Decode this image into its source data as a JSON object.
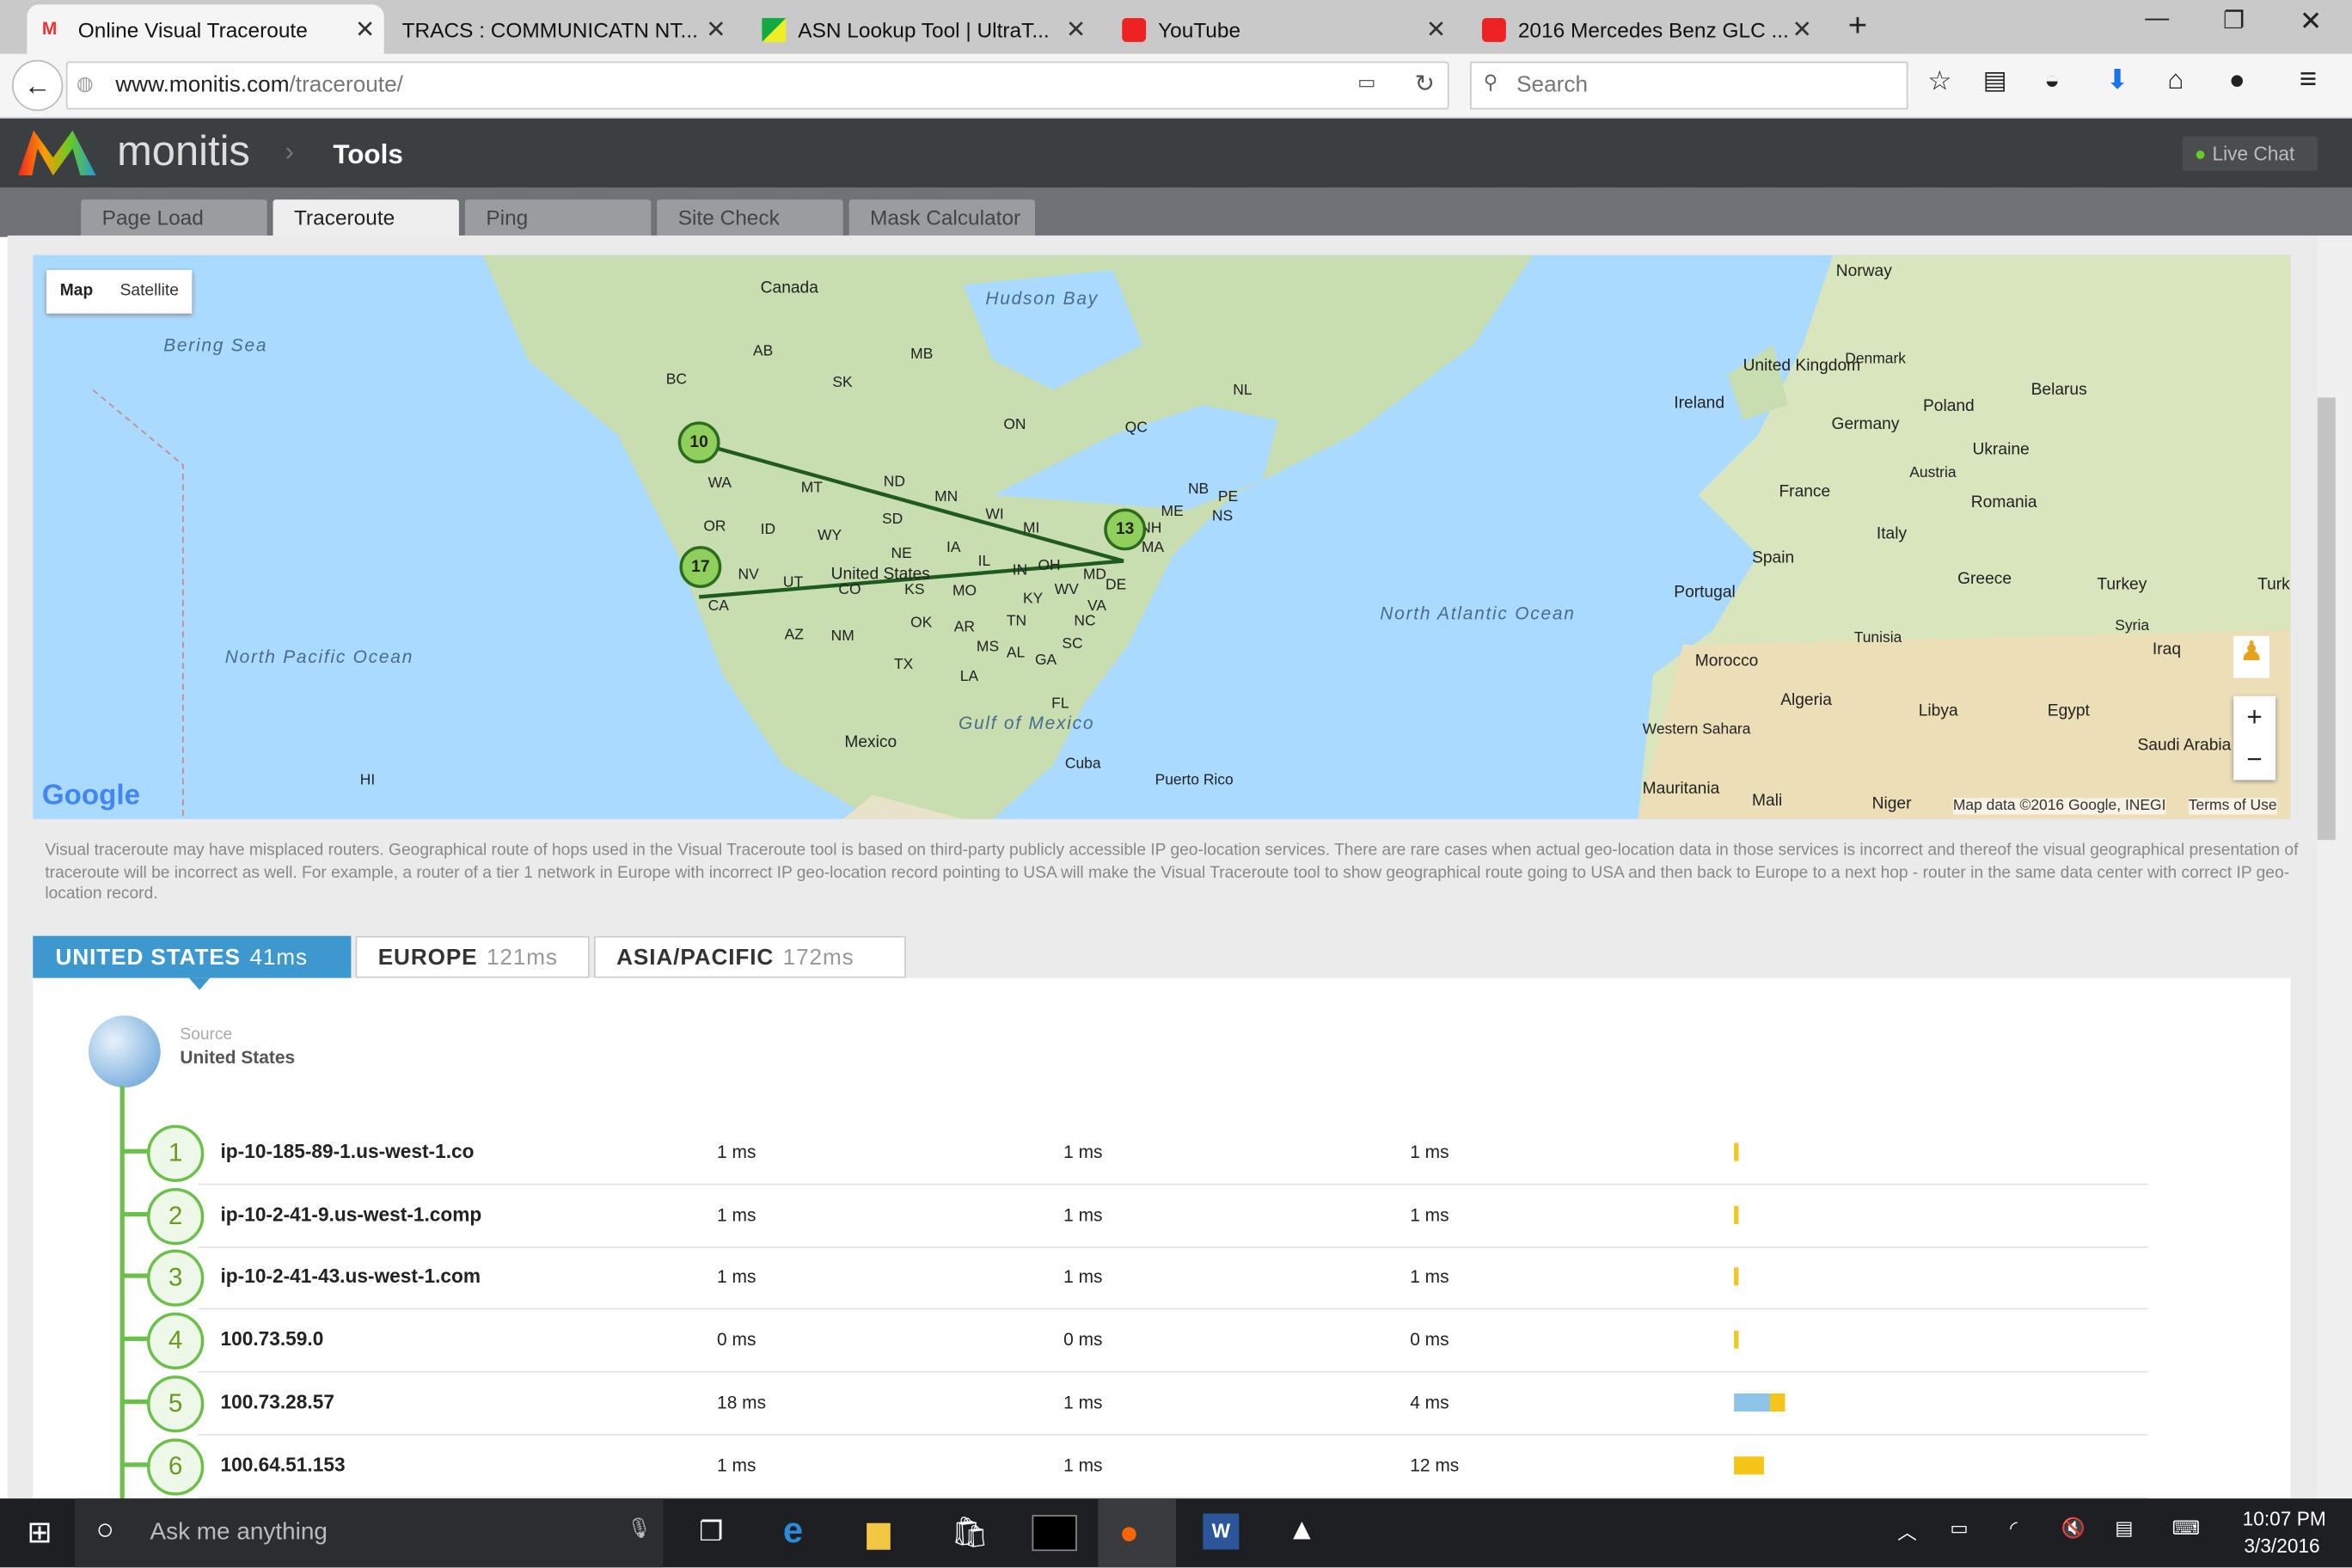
{
  "browser": {
    "tabs": [
      {
        "title": "Online Visual Traceroute"
      },
      {
        "title": "TRACS : COMMUNICATN NT..."
      },
      {
        "title": "ASN Lookup Tool | UltraT..."
      },
      {
        "title": "YouTube"
      },
      {
        "title": "2016 Mercedes Benz GLC ..."
      }
    ],
    "url_host": "www.monitis.com",
    "url_path": "/traceroute/",
    "search_placeholder": "Search"
  },
  "site": {
    "logo": "monitis",
    "breadcrumb": "Tools",
    "live_chat": "Live Chat",
    "tool_tabs": [
      "Page Load",
      "Traceroute",
      "Ping",
      "Site Check",
      "Mask Calculator"
    ],
    "active_tab": "Traceroute"
  },
  "map": {
    "type_buttons": [
      "Map",
      "Satellite"
    ],
    "google": "Google",
    "attribution": "Map data ©2016 Google, INEGI",
    "terms": "Terms of Use",
    "labels": [
      "Canada",
      "Hudson Bay",
      "Bering Sea",
      "AB",
      "MB",
      "BC",
      "SK",
      "ON",
      "QC",
      "NL",
      "WA",
      "MT",
      "ND",
      "MN",
      "OR",
      "ID",
      "SD",
      "WI",
      "MI",
      "WY",
      "NE",
      "IA",
      "IL",
      "IN",
      "OH",
      "NV",
      "UT",
      "CO",
      "KS",
      "MO",
      "KY",
      "WV",
      "VA",
      "MD",
      "DE",
      "United States",
      "CA",
      "AZ",
      "NM",
      "OK",
      "AR",
      "TN",
      "NC",
      "TX",
      "MS",
      "AL",
      "GA",
      "SC",
      "LA",
      "FL",
      "NB",
      "PE",
      "ME",
      "NS",
      "MA",
      "NH",
      "North Pacific Ocean",
      "Mexico",
      "Gulf of Mexico",
      "Cuba",
      "Puerto Rico",
      "HI",
      "North Atlantic Ocean",
      "Norway",
      "Denmark",
      "United Kingdom",
      "Ireland",
      "Belarus",
      "Poland",
      "Germany",
      "Ukraine",
      "France",
      "Austria",
      "Romania",
      "Italy",
      "Spain",
      "Portugal",
      "Greece",
      "Turkey",
      "Tunisia",
      "Syria",
      "Iraq",
      "Morocco",
      "Algeria",
      "Libya",
      "Egypt",
      "Western Sahara",
      "Mauritania",
      "Mali",
      "Niger",
      "Saudi Arabia",
      "Turk"
    ],
    "markers": [
      "10",
      "13",
      "17"
    ]
  },
  "disclaimer": "Visual traceroute may have misplaced routers. Geographical route of hops used in the Visual Traceroute tool is based on third-party publicly accessible IP geo-location services. There are rare cases when actual geo-location data in those services is incorrect and thereof the visual geographical presentation of traceroute will be incorrect as well. For example, a router of a tier 1 network in Europe with incorrect IP geo-location record pointing to USA will make the Visual Traceroute tool to show geographical route going to USA and then back to Europe to a next hop - router in the same data center with correct IP geo-location record.",
  "regions": [
    {
      "name": "UNITED STATES",
      "ms": "41ms"
    },
    {
      "name": "EUROPE",
      "ms": "121ms"
    },
    {
      "name": "ASIA/PACIFIC",
      "ms": "172ms"
    }
  ],
  "source": {
    "label": "Source",
    "value": "United States"
  },
  "hops": [
    {
      "n": "1",
      "host": "ip-10-185-89-1.us-west-1.co",
      "t1": "1 ms",
      "t2": "1 ms",
      "t3": "1 ms",
      "bar": [
        0,
        0.01
      ]
    },
    {
      "n": "2",
      "host": "ip-10-2-41-9.us-west-1.comp",
      "t1": "1 ms",
      "t2": "1 ms",
      "t3": "1 ms",
      "bar": [
        0,
        0.005
      ]
    },
    {
      "n": "3",
      "host": "ip-10-2-41-43.us-west-1.com",
      "t1": "1 ms",
      "t2": "1 ms",
      "t3": "1 ms",
      "bar": [
        0,
        0.005
      ]
    },
    {
      "n": "4",
      "host": "100.73.59.0",
      "t1": "0 ms",
      "t2": "0 ms",
      "t3": "0 ms",
      "bar": [
        0,
        0.005
      ]
    },
    {
      "n": "5",
      "host": "100.73.28.57",
      "t1": "18 ms",
      "t2": "1 ms",
      "t3": "4 ms",
      "bar": [
        0.6,
        0.2
      ]
    },
    {
      "n": "6",
      "host": "100.64.51.153",
      "t1": "1 ms",
      "t2": "1 ms",
      "t3": "12 ms",
      "bar": [
        0,
        0.4
      ]
    }
  ],
  "taskbar": {
    "search": "Ask me anything",
    "time": "10:07 PM",
    "date": "3/3/2016"
  }
}
